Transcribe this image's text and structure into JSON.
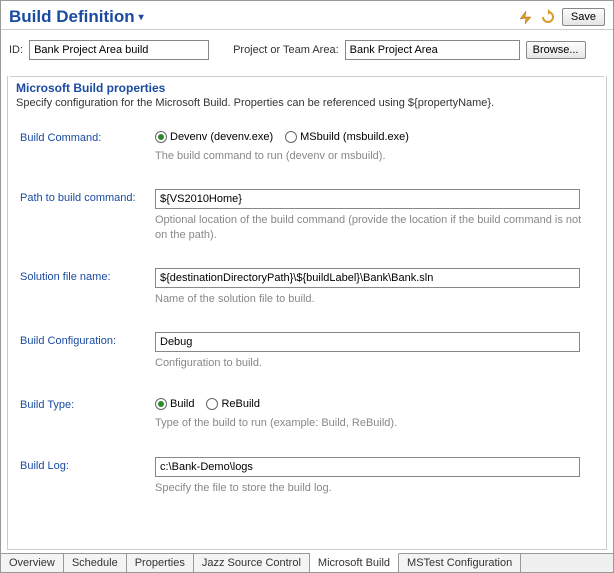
{
  "header": {
    "title": "Build Definition",
    "save_label": "Save"
  },
  "idrow": {
    "id_label": "ID:",
    "id_value": "Bank Project Area build",
    "project_label": "Project or Team Area:",
    "project_value": "Bank Project Area",
    "browse_label": "Browse..."
  },
  "section": {
    "title": "Microsoft Build properties",
    "desc": "Specify configuration for the Microsoft Build. Properties can be referenced using ${propertyName}."
  },
  "form": {
    "build_command": {
      "label": "Build Command:",
      "opt1": "Devenv (devenv.exe)",
      "opt2": "MSbuild (msbuild.exe)",
      "help": "The build command to run (devenv or msbuild)."
    },
    "path": {
      "label": "Path to build command:",
      "value": "${VS2010Home}",
      "help": "Optional location of the build command (provide the location if the build command is not on the path)."
    },
    "solution": {
      "label": "Solution file name:",
      "value": "${destinationDirectoryPath}\\${buildLabel}\\Bank\\Bank.sln",
      "help": "Name of the solution file to build."
    },
    "config": {
      "label": "Build Configuration:",
      "value": "Debug",
      "help": "Configuration to build."
    },
    "buildtype": {
      "label": "Build Type:",
      "opt1": "Build",
      "opt2": "ReBuild",
      "help": "Type of the build to run (example: Build, ReBuild)."
    },
    "log": {
      "label": "Build Log:",
      "value": "c:\\Bank-Demo\\logs",
      "help": "Specify the file to store the build log."
    }
  },
  "tabs": [
    "Overview",
    "Schedule",
    "Properties",
    "Jazz Source Control",
    "Microsoft Build",
    "MSTest Configuration"
  ]
}
